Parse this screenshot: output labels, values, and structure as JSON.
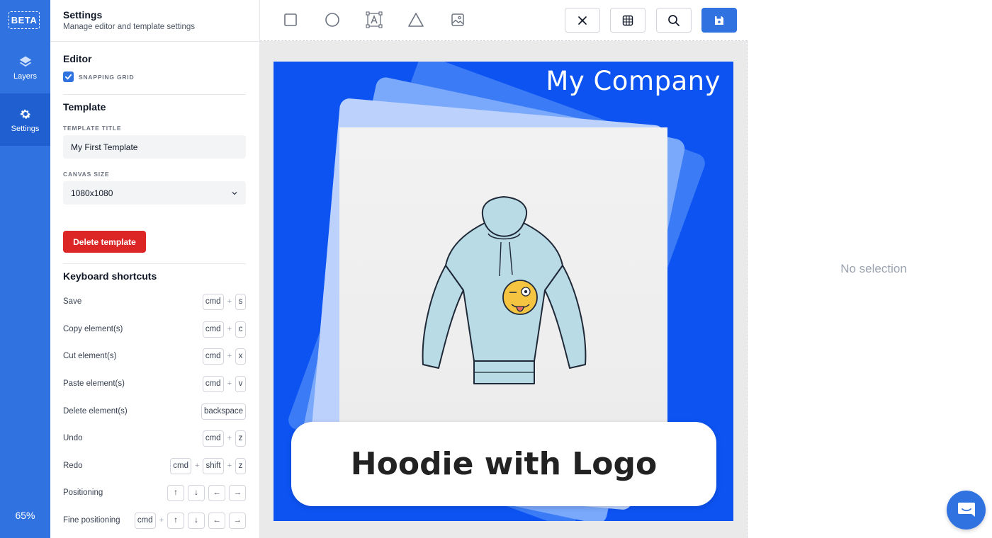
{
  "rail": {
    "beta": "BETA",
    "items": [
      {
        "label": "Layers",
        "icon": "layers-icon"
      },
      {
        "label": "Settings",
        "icon": "gear-icon",
        "active": true
      }
    ],
    "zoom": "65%"
  },
  "panel": {
    "title": "Settings",
    "subtitle": "Manage editor and template settings",
    "editor": {
      "title": "Editor",
      "snapping_label": "SNAPPING GRID",
      "snapping_checked": true
    },
    "template": {
      "title": "Template",
      "title_label": "TEMPLATE TITLE",
      "title_value": "My First Template",
      "size_label": "CANVAS SIZE",
      "size_value": "1080x1080",
      "delete_label": "Delete template"
    },
    "shortcuts": {
      "title": "Keyboard shortcuts",
      "rows": [
        {
          "label": "Save",
          "keys": [
            "cmd",
            "s"
          ]
        },
        {
          "label": "Copy element(s)",
          "keys": [
            "cmd",
            "c"
          ]
        },
        {
          "label": "Cut element(s)",
          "keys": [
            "cmd",
            "x"
          ]
        },
        {
          "label": "Paste element(s)",
          "keys": [
            "cmd",
            "v"
          ]
        },
        {
          "label": "Delete element(s)",
          "keys": [
            "backspace"
          ]
        },
        {
          "label": "Undo",
          "keys": [
            "cmd",
            "z"
          ]
        },
        {
          "label": "Redo",
          "keys": [
            "cmd",
            "shift",
            "z"
          ]
        },
        {
          "label": "Positioning",
          "keys": [
            "↑",
            "↓",
            "←",
            "→"
          ]
        },
        {
          "label": "Fine positioning",
          "keys": [
            "cmd",
            "↑",
            "↓",
            "←",
            "→"
          ]
        }
      ]
    }
  },
  "toolbar": {
    "tools": [
      "rectangle-tool-icon",
      "circle-tool-icon",
      "text-tool-icon",
      "triangle-tool-icon",
      "image-tool-icon"
    ],
    "buttons": [
      "close-icon",
      "grid-icon",
      "search-icon",
      "save-icon"
    ]
  },
  "canvas": {
    "company": "My Company",
    "caption": "Hoodie with Logo",
    "colors": {
      "background": "#0d53f2",
      "accent": "#2f72e0",
      "danger": "#dc2626"
    }
  },
  "right": {
    "empty_text": "No selection"
  }
}
